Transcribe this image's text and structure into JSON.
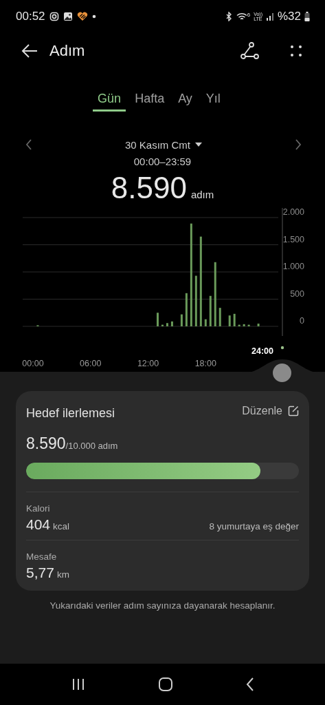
{
  "status_bar": {
    "time": "00:52",
    "network_badge": [
      "Vo))",
      "LTE"
    ],
    "wifi_badge": "6",
    "battery": "%32"
  },
  "app_bar": {
    "title": "Adım"
  },
  "tabs": [
    {
      "label": "Gün",
      "selected": true
    },
    {
      "label": "Hafta",
      "selected": false
    },
    {
      "label": "Ay",
      "selected": false
    },
    {
      "label": "Yıl",
      "selected": false
    }
  ],
  "date_nav": {
    "date": "30 Kasım Cmt",
    "time_range": "00:00–23:59",
    "total": "8.590",
    "unit": "adım"
  },
  "chart": {
    "cursor_label": "24:00",
    "chart_data": {
      "type": "bar",
      "x": [
        0.5,
        13,
        13.5,
        14,
        14.5,
        15.5,
        16,
        16.5,
        17,
        17.5,
        18,
        18.5,
        19,
        19.5,
        20.5,
        21,
        21.5,
        22,
        22.5,
        23.5
      ],
      "series": [
        {
          "color": "#6a9a5a",
          "values": [
            20,
            250,
            30,
            60,
            90,
            220,
            610,
            1890,
            930,
            1650,
            130,
            560,
            1180,
            340,
            200,
            230,
            30,
            40,
            30,
            50
          ]
        }
      ],
      "grid": true,
      "xlim": [
        -1,
        26
      ],
      "ylim": [
        0,
        2000
      ],
      "xticks": [
        {
          "value": 0,
          "label": "00:00"
        },
        {
          "value": 6,
          "label": "06:00"
        },
        {
          "value": 12,
          "label": "12:00"
        },
        {
          "value": 18,
          "label": "18:00"
        }
      ],
      "yticks": [
        {
          "value": 0,
          "label": "0"
        },
        {
          "value": 500,
          "label": "500"
        },
        {
          "value": 1000,
          "label": "1.000"
        },
        {
          "value": 1500,
          "label": "1.500"
        },
        {
          "value": 2000,
          "label": "2.000"
        }
      ]
    }
  },
  "goal_card": {
    "title": "Hedef ilerlemesi",
    "edit_label": "Düzenle",
    "steps": "8.590",
    "goal": "/10.000 adım",
    "level": 0.86,
    "stats": [
      {
        "label": "Kalori",
        "value": "404",
        "unit": "kcal",
        "note": "8 yumurtaya eş değer"
      },
      {
        "label": "Mesafe",
        "value": "5,77",
        "unit": "km"
      }
    ]
  },
  "footnote": "Yukarıdaki veriler adım sayınıza dayanarak hesaplanır."
}
